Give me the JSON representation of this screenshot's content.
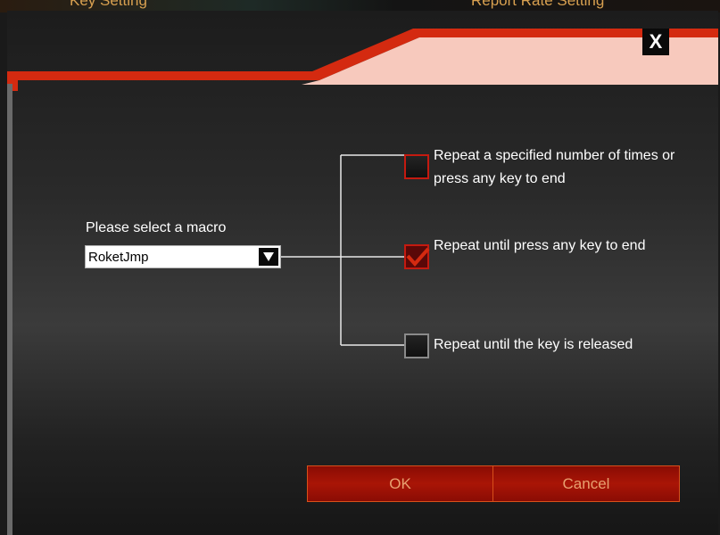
{
  "app": {
    "tabs_behind": [
      "Key Setting",
      "Report Rate Setting"
    ]
  },
  "dialog": {
    "close_label": "X",
    "macro": {
      "label": "Please select a macro",
      "selected": "RoketJmp"
    },
    "options": [
      {
        "label": "Repeat a specified number of times or press any key to end",
        "checked": false
      },
      {
        "label": "Repeat until press any key to end",
        "checked": true
      },
      {
        "label": "Repeat until the key is released",
        "checked": false
      }
    ],
    "buttons": {
      "ok": "OK",
      "cancel": "Cancel"
    }
  },
  "colors": {
    "accent_red": "#d42a10",
    "button_red": "#a91506",
    "header_pink": "#f7c9bd"
  }
}
